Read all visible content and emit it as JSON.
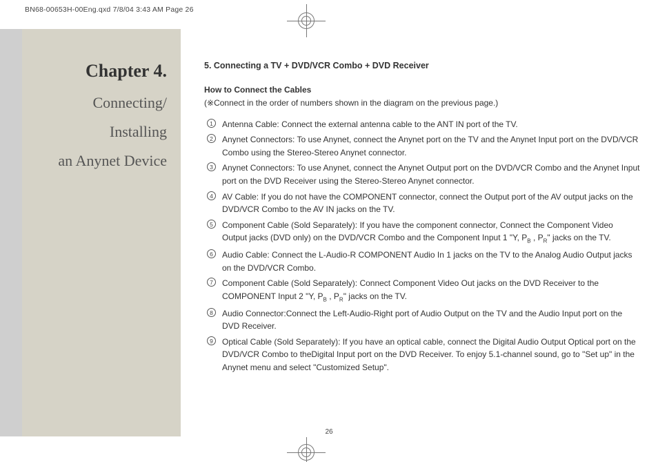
{
  "header": {
    "slug": "BN68-00653H-00Eng.qxd  7/8/04 3:43 AM  Page 26"
  },
  "sidebar": {
    "chapter": "Chapter 4.",
    "line1": "Connecting/",
    "line2": "Installing",
    "line3": "an Anynet Device"
  },
  "section": {
    "title": "5. Connecting a TV + DVD/VCR Combo + DVD Receiver",
    "howto": "How to Connect the Cables",
    "note_prefix": "(",
    "note_symbol": "※",
    "note_body": "Connect in the order of numbers shown in the diagram on the previous page.)"
  },
  "steps": [
    {
      "n": "1",
      "text": "Antenna Cable: Connect the external antenna cable to the ANT IN port of the TV."
    },
    {
      "n": "2",
      "text": "Anynet Connectors: To use Anynet, connect the Anynet port on the TV and the Anynet Input port on the DVD/VCR Combo using the Stereo-Stereo Anynet connector."
    },
    {
      "n": "3",
      "text": "Anynet Connectors: To use Anynet, connect the Anynet Output port on the DVD/VCR Combo and the Anynet Input port on the DVD Receiver using the Stereo-Stereo Anynet connector."
    },
    {
      "n": "4",
      "text": "AV Cable: If you do not have the COMPONENT connector, connect the Output port of the AV output jacks on the DVD/VCR Combo to the AV IN jacks on the TV."
    },
    {
      "n": "5",
      "text": "Component Cable (Sold Separately): If you have the component connector, Connect the Component Video Output jacks (DVD only) on the DVD/VCR Combo and the Component Input 1 \"Y, P_B , P_R\" jacks on the TV."
    },
    {
      "n": "6",
      "text": "Audio Cable: Connect the L-Audio-R COMPONENT Audio In 1 jacks on the TV to the Analog Audio Output jacks on the DVD/VCR Combo."
    },
    {
      "n": "7",
      "text": "Component Cable (Sold Separately): Connect Component Video Out jacks on the DVD Receiver to the COMPONENT Input 2 \"Y, P_B , P_R\" jacks on the TV."
    },
    {
      "n": "8",
      "text": "Audio Connector:Connect the Left-Audio-Right port of Audio Output on the TV and the Audio Input port on the DVD Receiver."
    },
    {
      "n": "9",
      "text": "Optical Cable (Sold Separately): If you have an optical cable, connect the Digital Audio Output Optical port on the DVD/VCR Combo to theDigital Input port on the DVD Receiver. To enjoy 5.1-channel sound, go to \"Set up\" in the Anynet menu and select \"Customized Setup\"."
    }
  ],
  "page_number": "26"
}
